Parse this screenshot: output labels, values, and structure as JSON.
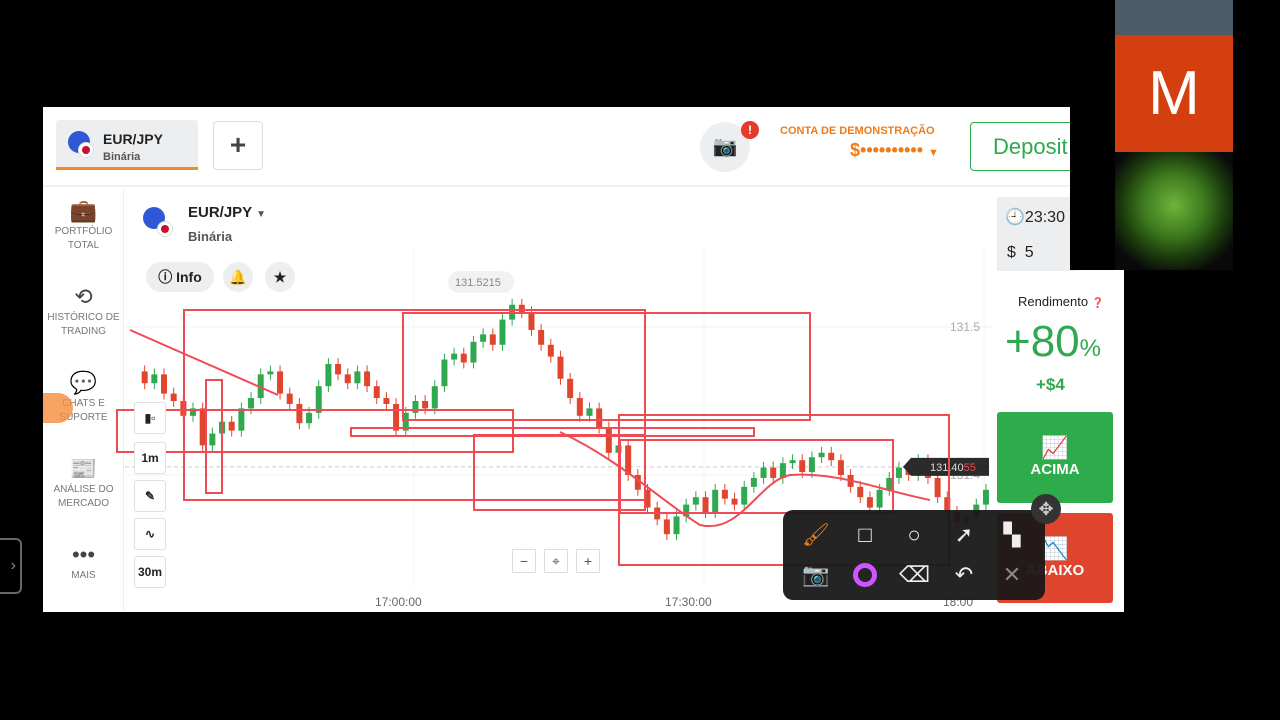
{
  "tab": {
    "pair": "EUR/JPY",
    "type": "Binária",
    "add": "+"
  },
  "header": {
    "account_label": "CONTA DE DEMONSTRAÇÃO",
    "balance": "$••••••••••",
    "deposit": "Deposit",
    "alert": "!"
  },
  "sidebar": {
    "items": [
      {
        "label1": "PORTFÓLIO",
        "label2": "TOTAL",
        "icon": "briefcase-icon"
      },
      {
        "label1": "HISTÓRICO DE",
        "label2": "TRADING",
        "icon": "history-icon"
      },
      {
        "label1": "CHATS E",
        "label2": "SUPORTE",
        "icon": "chat-icon"
      },
      {
        "label1": "ANÁLISE DO",
        "label2": "MERCADO",
        "icon": "news-icon"
      },
      {
        "label1": "MAIS",
        "label2": "",
        "icon": "more-icon"
      }
    ]
  },
  "asset": {
    "pair": "EUR/JPY",
    "type": "Binária",
    "info": "Info"
  },
  "chart_tools": {
    "timeframe": "1m",
    "expiry": "30m"
  },
  "chart_data": {
    "type": "candlestick",
    "y_ticks": [
      "131.5",
      "131.4"
    ],
    "x_ticks": [
      "17:00:00",
      "17:30:00",
      "18:00"
    ],
    "max_label": "131.5215",
    "current_price": "131.40",
    "current_price_tail": "55",
    "interval": "1m",
    "closes": [
      131.47,
      131.462,
      131.468,
      131.455,
      131.45,
      131.44,
      131.445,
      131.42,
      131.428,
      131.436,
      131.43,
      131.445,
      131.452,
      131.468,
      131.47,
      131.455,
      131.448,
      131.435,
      131.442,
      131.46,
      131.475,
      131.468,
      131.462,
      131.47,
      131.46,
      131.452,
      131.448,
      131.43,
      131.442,
      131.45,
      131.445,
      131.46,
      131.478,
      131.482,
      131.476,
      131.49,
      131.495,
      131.488,
      131.505,
      131.515,
      131.51,
      131.498,
      131.488,
      131.48,
      131.465,
      131.452,
      131.44,
      131.445,
      131.432,
      131.415,
      131.42,
      131.4,
      131.39,
      131.378,
      131.37,
      131.36,
      131.372,
      131.38,
      131.385,
      131.375,
      131.39,
      131.384,
      131.38,
      131.392,
      131.398,
      131.405,
      131.398,
      131.408,
      131.41,
      131.402,
      131.412,
      131.415,
      131.41,
      131.4,
      131.392,
      131.385,
      131.378,
      131.39,
      131.398,
      131.405,
      131.4,
      131.41,
      131.398,
      131.385,
      131.375,
      131.368,
      131.372,
      131.38,
      131.39
    ],
    "colors": {
      "up": "#2fa84f",
      "down": "#e0452d",
      "annotation": "#f04a55"
    }
  },
  "trade": {
    "time": "23:30",
    "amount_symbol": "$",
    "amount": "5",
    "yield_label": "Rendimento",
    "yield": "+80",
    "yield_unit": "%",
    "profit": "+$4",
    "up": "ACIMA",
    "down": "ABAIXO"
  },
  "webcam": {
    "letter": "M"
  }
}
